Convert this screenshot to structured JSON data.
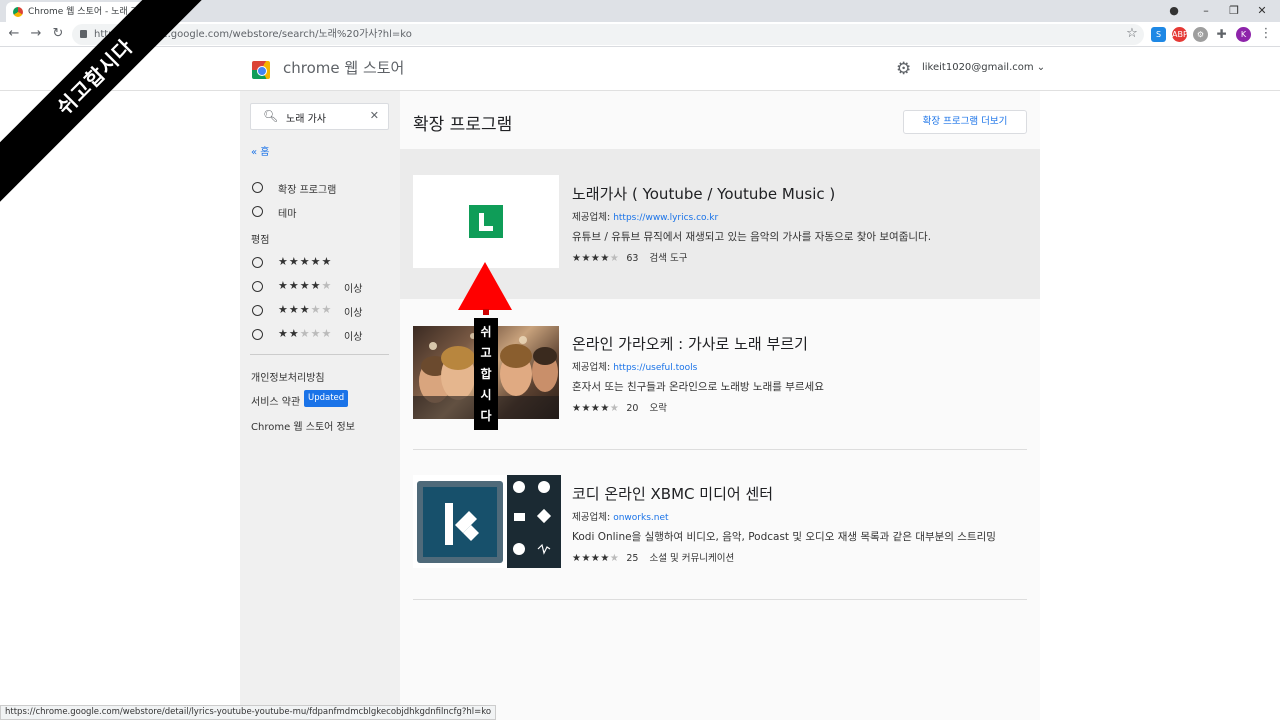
{
  "browser": {
    "tab_title": "Chrome 웹 스토어 - 노래 가사",
    "url": "https://chrome.google.com/webstore/search/노래%20가사?hl=ko",
    "url_visible": "https://chrome.google.com/webstore/search/노래%20가사?hl=ko"
  },
  "store": {
    "title": "chrome 웹 스토어",
    "account": "likeit1020@gmail.com"
  },
  "sidebar": {
    "search_value": "노래 가사",
    "home_link": "« 홈",
    "filters": [
      {
        "label": "확장 프로그램"
      },
      {
        "label": "테마"
      }
    ],
    "rating_label": "평점",
    "ratings": [
      {
        "stars": 5,
        "suffix": ""
      },
      {
        "stars": 4,
        "suffix": "이상"
      },
      {
        "stars": 3,
        "suffix": "이상"
      },
      {
        "stars": 2,
        "suffix": "이상"
      }
    ],
    "footer_links": [
      {
        "label": "개인정보처리방침"
      },
      {
        "label": "서비스 약관"
      },
      {
        "label": "Chrome 웹 스토어 정보"
      }
    ],
    "updated_badge": "Updated"
  },
  "main": {
    "heading": "확장 프로그램",
    "more_button": "확장 프로그램 더보기",
    "provider_label": "제공업체:",
    "items": [
      {
        "title": "노래가사 ( Youtube / Youtube Music )",
        "provider": "https://www.lyrics.co.kr",
        "description": "유튜브 / 유튜브 뮤직에서 재생되고 있는 음악의 가사를 자동으로 찾아 보여줍니다.",
        "rating": 4,
        "rating_count": "63",
        "category": "검색 도구"
      },
      {
        "title": "온라인 가라오케 : 가사로 노래 부르기",
        "provider": "https://useful.tools",
        "description": "혼자서 또는 친구들과 온라인으로 노래방 노래를 부르세요",
        "rating": 4,
        "rating_count": "20",
        "category": "오락"
      },
      {
        "title": "코디 온라인 XBMC 미디어 센터",
        "provider": "onworks.net",
        "description": "Kodi Online을 실행하여 비디오, 음악, Podcast 및 오디오 재생 목록과 같은 대부분의 스트리밍",
        "rating": 4,
        "rating_count": "25",
        "category": "소셜 및 커뮤니케이션"
      }
    ]
  },
  "status_bar": "https://chrome.google.com/webstore/detail/lyrics-youtube-youtube-mu/fdpanfmdmcblgkecobjdhkgdnfilncfg?hl=ko",
  "overlay": {
    "banner_text": "쉬고합시다",
    "vertical_chars": [
      "쉬",
      "고",
      "합",
      "시",
      "다"
    ]
  },
  "colors": {
    "accent": "#1a73e8",
    "sidebar_bg": "#f0f0f0",
    "highlight_bg": "#ebebeb",
    "overlay_red": "#ff0000"
  }
}
